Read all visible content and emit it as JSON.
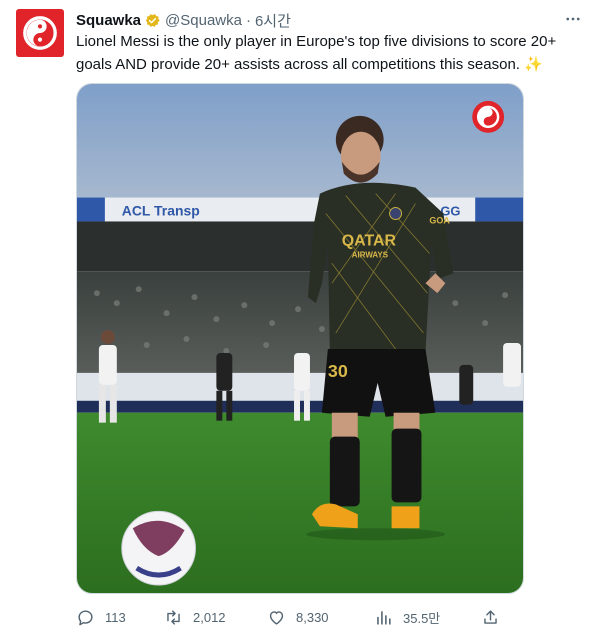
{
  "tweet": {
    "author": {
      "display_name": "Squawka",
      "handle": "@Squawka",
      "verified": true,
      "avatar_icon": "squawka-logo-icon",
      "brand_color": "#e0242a"
    },
    "separator": "·",
    "timestamp": "6시간",
    "more_icon": "more-dots-icon",
    "text": "Lionel Messi is the only player in Europe's top five divisions to score 20+ goals AND provide 20+ assists across all competitions this season. ✨",
    "media": {
      "stadium_banner": "ACL Transp",
      "stadium_banner_right": "GG",
      "sponsor_text_line1": "QATAR",
      "sponsor_text_line2": "AIRWAYS",
      "shirt_number": "30",
      "sleeve_text": "GOA"
    },
    "actions": {
      "reply": {
        "icon": "reply-icon",
        "count": "113"
      },
      "retweet": {
        "icon": "retweet-icon",
        "count": "2,012"
      },
      "like": {
        "icon": "heart-icon",
        "count": "8,330"
      },
      "views": {
        "icon": "views-chart-icon",
        "count": "35.5만"
      },
      "share": {
        "icon": "share-icon"
      }
    }
  }
}
